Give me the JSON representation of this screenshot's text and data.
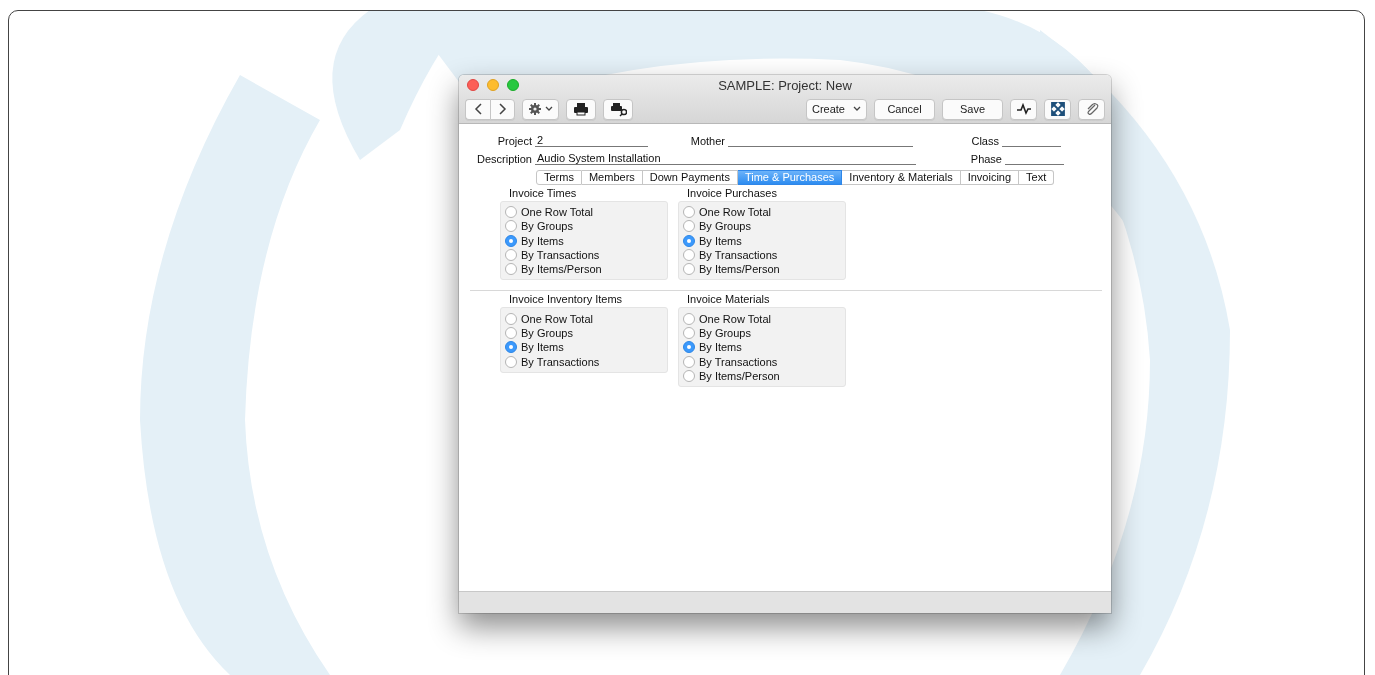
{
  "window": {
    "title": "SAMPLE: Project: New"
  },
  "toolbar": {
    "create": "Create",
    "buttons": [
      "Cancel",
      "Save"
    ]
  },
  "header_rows": [
    [
      {
        "label": "Project",
        "value": "2"
      },
      {
        "label": "Mother"
      },
      {
        "label": "Class"
      }
    ],
    [
      {
        "label": "Description",
        "value": "Audio System Installation"
      },
      {
        "label": "Phase"
      }
    ]
  ],
  "tabs": [
    {
      "label": "Terms",
      "selected": false
    },
    {
      "label": "Members",
      "selected": false
    },
    {
      "label": "Down Payments",
      "selected": false
    },
    {
      "label": "Time & Purchases",
      "selected": true
    },
    {
      "label": "Inventory & Materials",
      "selected": false
    },
    {
      "label": "Invoicing",
      "selected": false
    },
    {
      "label": "Text",
      "selected": false
    }
  ],
  "sections": [
    {
      "groups": [
        {
          "title": "Invoice Times",
          "options": [
            {
              "label": "One Row Total",
              "selected": false
            },
            {
              "label": "By Groups",
              "selected": false
            },
            {
              "label": "By Items",
              "selected": true
            },
            {
              "label": "By Transactions",
              "selected": false
            },
            {
              "label": "By Items/Person",
              "selected": false
            }
          ]
        },
        {
          "title": "Invoice Purchases",
          "options": [
            {
              "label": "One Row Total",
              "selected": false
            },
            {
              "label": "By Groups",
              "selected": false
            },
            {
              "label": "By Items",
              "selected": true
            },
            {
              "label": "By Transactions",
              "selected": false
            },
            {
              "label": "By Items/Person",
              "selected": false
            }
          ]
        }
      ]
    },
    {
      "groups": [
        {
          "title": "Invoice Inventory Items",
          "options": [
            {
              "label": "One Row Total",
              "selected": false
            },
            {
              "label": "By Groups",
              "selected": false
            },
            {
              "label": "By Items",
              "selected": true
            },
            {
              "label": "By Transactions",
              "selected": false
            }
          ]
        },
        {
          "title": "Invoice Materials",
          "options": [
            {
              "label": "One Row Total",
              "selected": false
            },
            {
              "label": "By Groups",
              "selected": false
            },
            {
              "label": "By Items",
              "selected": true
            },
            {
              "label": "By Transactions",
              "selected": false
            },
            {
              "label": "By Items/Person",
              "selected": false
            }
          ]
        }
      ]
    }
  ]
}
